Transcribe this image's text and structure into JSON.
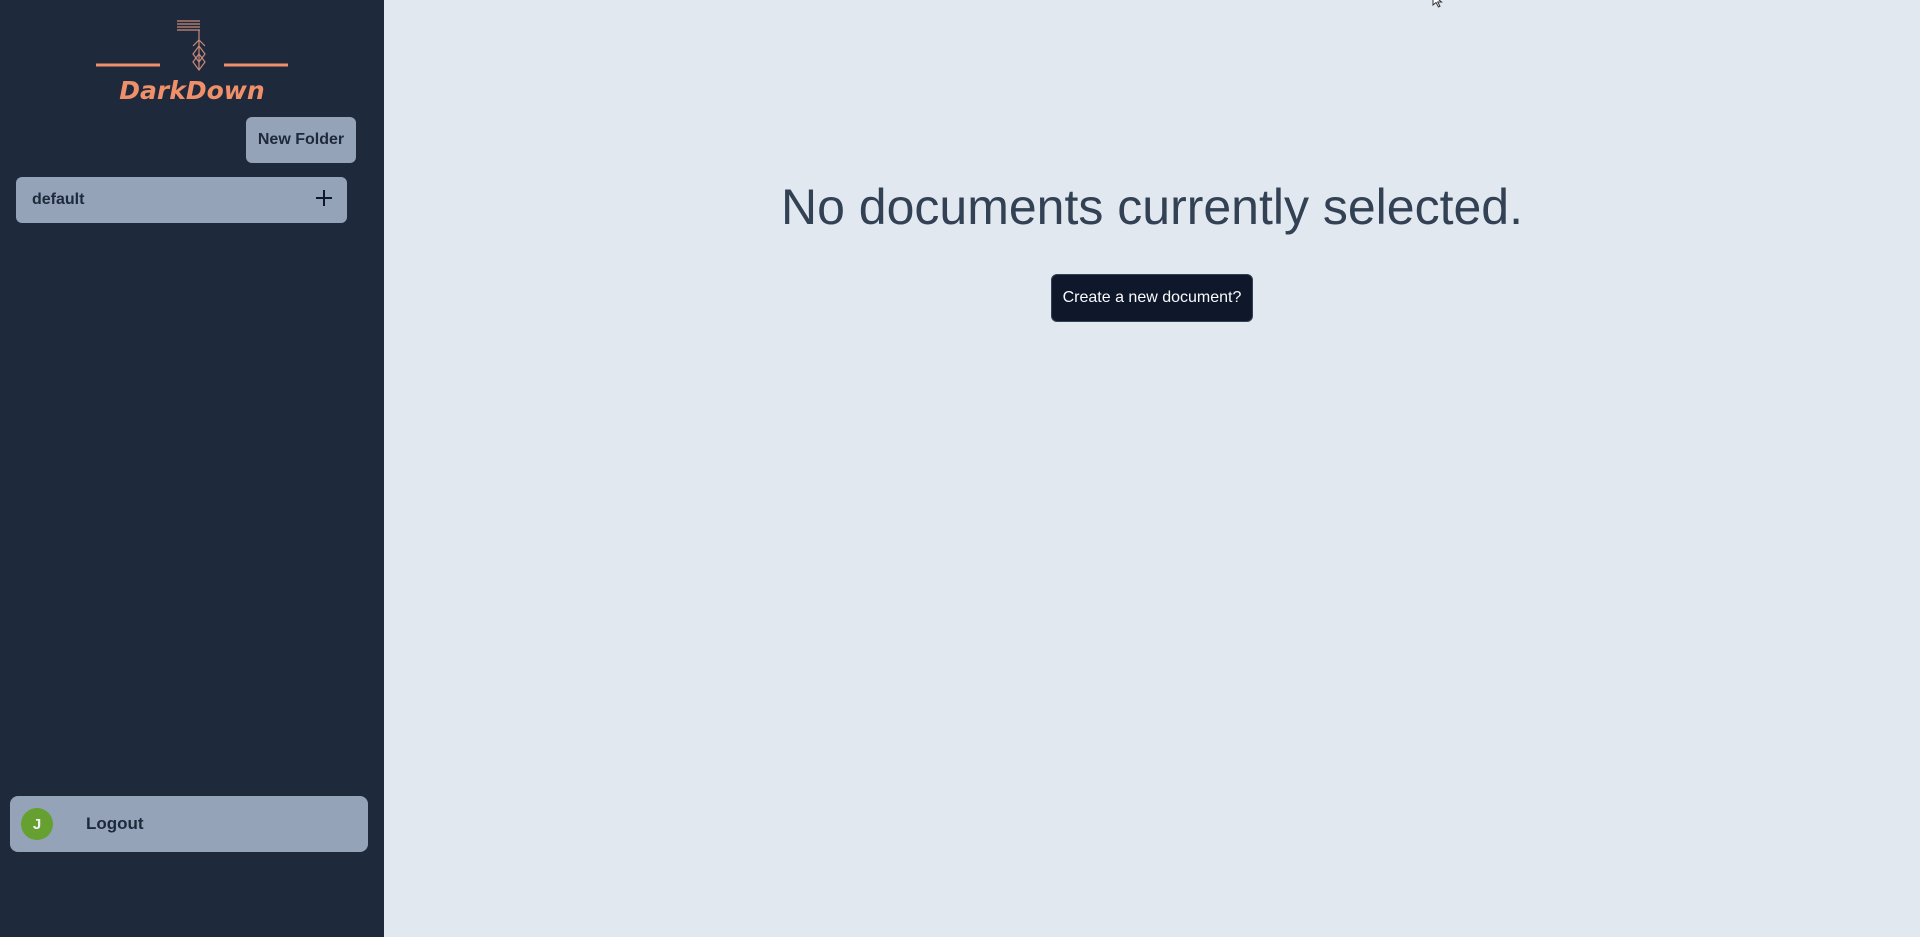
{
  "sidebar": {
    "logo_text": "DarkDown",
    "new_folder_label": "New Folder",
    "folders": [
      {
        "label": "default"
      }
    ],
    "user": {
      "avatar_initial": "J",
      "logout_label": "Logout"
    }
  },
  "main": {
    "empty_message": "No documents currently selected.",
    "create_button_label": "Create a new document?"
  },
  "colors": {
    "sidebar_bg": "#1e293b",
    "main_bg": "#e2e8f0",
    "item_bg": "#94a3b8",
    "accent": "#f0906a",
    "avatar": "#65a030",
    "button_dark": "#0f172a"
  }
}
